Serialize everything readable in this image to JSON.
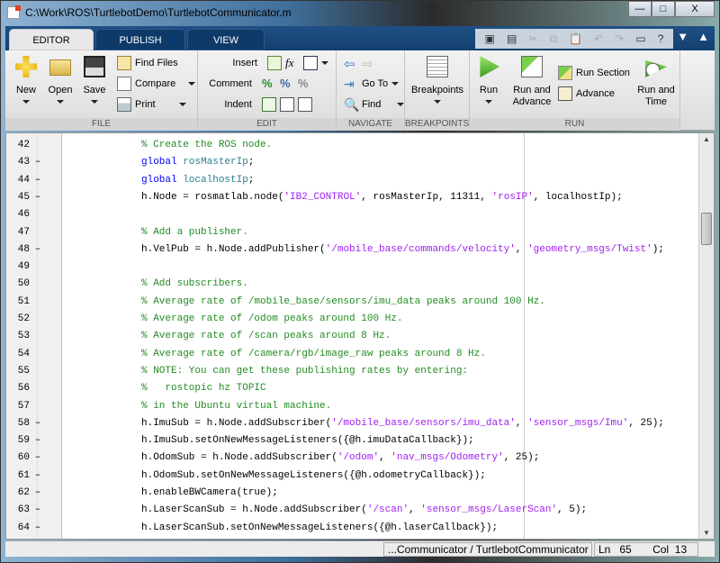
{
  "window": {
    "title": "C:\\Work\\ROS\\TurtlebotDemo\\TurtlebotCommunicator.m",
    "minimize": "—",
    "maximize": "□",
    "close": "X"
  },
  "tabs": [
    {
      "label": "EDITOR",
      "active": true
    },
    {
      "label": "PUBLISH"
    },
    {
      "label": "VIEW"
    }
  ],
  "quick_access": [
    "new-icon",
    "save-icon",
    "cut-icon",
    "copy-icon",
    "paste-icon",
    "undo-icon",
    "redo-icon",
    "window-icon",
    "help-icon"
  ],
  "ribbon": {
    "file": {
      "label": "FILE",
      "new": "New",
      "open": "Open",
      "save": "Save",
      "find_files": "Find Files",
      "compare": "Compare",
      "print": "Print"
    },
    "edit": {
      "label": "EDIT",
      "insert": "Insert",
      "comment": "Comment",
      "indent": "Indent"
    },
    "navigate": {
      "label": "NAVIGATE",
      "goto": "Go To",
      "find": "Find"
    },
    "breakpoints": {
      "label": "BREAKPOINTS",
      "breakpoints": "Breakpoints"
    },
    "run": {
      "label": "RUN",
      "run": "Run",
      "run_advance_1": "Run and",
      "run_advance_2": "Advance",
      "run_section": "Run Section",
      "advance": "Advance",
      "run_time_1": "Run and",
      "run_time_2": "Time"
    }
  },
  "code": [
    {
      "n": "42",
      "d": false,
      "tokens": [
        [
          "com",
          "% Create the ROS node."
        ]
      ]
    },
    {
      "n": "43",
      "d": true,
      "tokens": [
        [
          "kw",
          "global"
        ],
        [
          "",
          ""
        ],
        [
          "var",
          " rosMasterIp"
        ],
        [
          "",
          ";"
        ]
      ]
    },
    {
      "n": "44",
      "d": true,
      "tokens": [
        [
          "kw",
          "global"
        ],
        [
          "var",
          " localhostIp"
        ],
        [
          "",
          ";"
        ]
      ]
    },
    {
      "n": "45",
      "d": true,
      "tokens": [
        [
          "",
          "h.Node = rosmatlab.node("
        ],
        [
          "str",
          "'IB2_CONTROL'"
        ],
        [
          "",
          ", rosMasterIp, 11311, "
        ],
        [
          "str",
          "'rosIP'"
        ],
        [
          "",
          ", localhostIp);"
        ]
      ]
    },
    {
      "n": "46",
      "d": false,
      "tokens": []
    },
    {
      "n": "47",
      "d": false,
      "tokens": [
        [
          "com",
          "% Add a publisher."
        ]
      ]
    },
    {
      "n": "48",
      "d": true,
      "tokens": [
        [
          "",
          "h.VelPub = h.Node.addPublisher("
        ],
        [
          "str",
          "'/mobile_base/commands/velocity'"
        ],
        [
          "",
          ", "
        ],
        [
          "str",
          "'geometry_msgs/Twist'"
        ],
        [
          "",
          ");"
        ]
      ]
    },
    {
      "n": "49",
      "d": false,
      "tokens": []
    },
    {
      "n": "50",
      "d": false,
      "tokens": [
        [
          "com",
          "% Add subscribers."
        ]
      ]
    },
    {
      "n": "51",
      "d": false,
      "tokens": [
        [
          "com",
          "% Average rate of /mobile_base/sensors/imu_data peaks around 100 Hz."
        ]
      ]
    },
    {
      "n": "52",
      "d": false,
      "tokens": [
        [
          "com",
          "% Average rate of /odom peaks around 100 Hz."
        ]
      ]
    },
    {
      "n": "53",
      "d": false,
      "tokens": [
        [
          "com",
          "% Average rate of /scan peaks around 8 Hz."
        ]
      ]
    },
    {
      "n": "54",
      "d": false,
      "tokens": [
        [
          "com",
          "% Average rate of /camera/rgb/image_raw peaks around 8 Hz."
        ]
      ]
    },
    {
      "n": "55",
      "d": false,
      "tokens": [
        [
          "com",
          "% NOTE: You can get these publishing rates by entering:"
        ]
      ]
    },
    {
      "n": "56",
      "d": false,
      "tokens": [
        [
          "com",
          "%   rostopic hz TOPIC"
        ]
      ]
    },
    {
      "n": "57",
      "d": false,
      "tokens": [
        [
          "com",
          "% in the Ubuntu virtual machine."
        ]
      ]
    },
    {
      "n": "58",
      "d": true,
      "tokens": [
        [
          "",
          "h.ImuSub = h.Node.addSubscriber("
        ],
        [
          "str",
          "'/mobile_base/sensors/imu_data'"
        ],
        [
          "",
          ", "
        ],
        [
          "str",
          "'sensor_msgs/Imu'"
        ],
        [
          "",
          ", 25);"
        ]
      ]
    },
    {
      "n": "59",
      "d": true,
      "tokens": [
        [
          "",
          "h.ImuSub.setOnNewMessageListeners({@h.imuDataCallback});"
        ]
      ]
    },
    {
      "n": "60",
      "d": true,
      "tokens": [
        [
          "",
          "h.OdomSub = h.Node.addSubscriber("
        ],
        [
          "str",
          "'/odom'"
        ],
        [
          "",
          ", "
        ],
        [
          "str",
          "'nav_msgs/Odometry'"
        ],
        [
          "",
          ", 25);"
        ]
      ]
    },
    {
      "n": "61",
      "d": true,
      "tokens": [
        [
          "",
          "h.OdomSub.setOnNewMessageListeners({@h.odometryCallback});"
        ]
      ]
    },
    {
      "n": "62",
      "d": true,
      "tokens": [
        [
          "",
          "h.enableBWCamera(true);"
        ]
      ]
    },
    {
      "n": "63",
      "d": true,
      "tokens": [
        [
          "",
          "h.LaserScanSub = h.Node.addSubscriber("
        ],
        [
          "str",
          "'/scan'"
        ],
        [
          "",
          ", "
        ],
        [
          "str",
          "'sensor_msgs/LaserScan'"
        ],
        [
          "",
          ", 5);"
        ]
      ]
    },
    {
      "n": "64",
      "d": true,
      "tokens": [
        [
          "",
          "h.LaserScanSub.setOnNewMessageListeners({@h.laserCallback});"
        ]
      ]
    }
  ],
  "status": {
    "file": "...Communicator / TurtlebotCommunicator",
    "ln_label": "Ln",
    "ln": "65",
    "col_label": "Col",
    "col": "13"
  }
}
